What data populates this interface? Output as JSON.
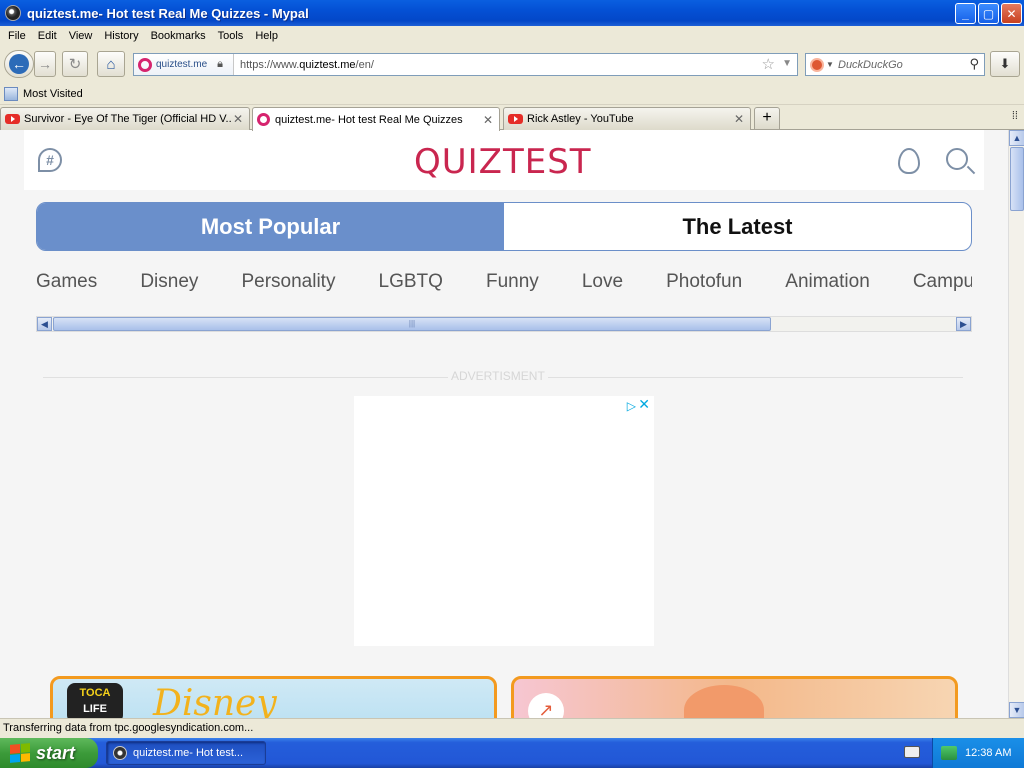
{
  "window": {
    "title": "quiztest.me- Hot test Real Me Quizzes - Mypal",
    "minimize": "_",
    "maximize": "▢",
    "close": "✕"
  },
  "menu": [
    "File",
    "Edit",
    "View",
    "History",
    "Bookmarks",
    "Tools",
    "Help"
  ],
  "nav": {
    "back": "←",
    "forward": "→",
    "reload": "↻",
    "home": "⌂",
    "site_domain": "quiztest.me",
    "url_prefix": "https://www.",
    "url_host": "quiztest.me",
    "url_path": "/en/",
    "search_placeholder": "DuckDuckGo",
    "download": "⬇"
  },
  "bookmarks": {
    "most_visited": "Most Visited"
  },
  "tabs": [
    {
      "title": "Survivor - Eye Of The Tiger (Official HD V...",
      "icon": "youtube-icon",
      "active": false
    },
    {
      "title": "quiztest.me- Hot test Real Me Quizzes",
      "icon": "quiztest-icon",
      "active": true
    },
    {
      "title": "Rick Astley - YouTube",
      "icon": "youtube-icon",
      "active": false
    }
  ],
  "page": {
    "logo": "QUIZTEST",
    "segments": {
      "popular": "Most Popular",
      "latest": "The Latest"
    },
    "categories": [
      "Games",
      "Disney",
      "Personality",
      "LGBTQ",
      "Funny",
      "Love",
      "Photofun",
      "Animation",
      "Campu"
    ],
    "ad_label": "ADVERTISMENT",
    "card1": {
      "toca_top": "TOCA",
      "toca_bottom": "LIFE",
      "disney": "Disney"
    }
  },
  "status": "Transferring data from tpc.googlesyndication.com...",
  "taskbar": {
    "start": "start",
    "task": "quiztest.me- Hot test...",
    "clock": "12:38 AM"
  },
  "colors": {
    "accent": "#6a8fcb",
    "logo": "#c9264f",
    "card_border": "#f39a1f"
  }
}
